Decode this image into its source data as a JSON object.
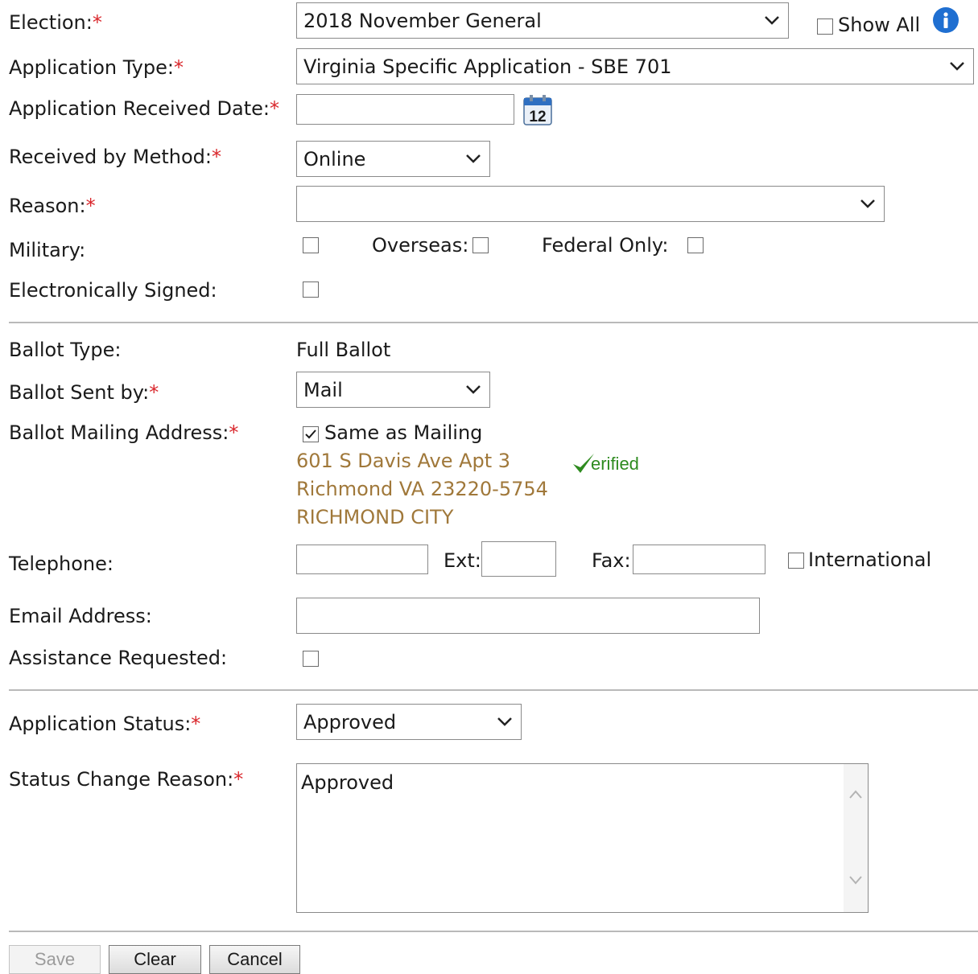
{
  "election": {
    "label": "Election:",
    "value": "2018 November General",
    "show_all_label": "Show All",
    "show_all_checked": false
  },
  "application_type": {
    "label": "Application Type:",
    "value": "Virginia Specific Application - SBE 701"
  },
  "received_date": {
    "label": "Application Received Date:",
    "value": "",
    "calendar_day": "12"
  },
  "received_method": {
    "label": "Received by Method:",
    "value": "Online"
  },
  "reason": {
    "label": "Reason:",
    "value": ""
  },
  "military": {
    "label": "Military:",
    "checked": false
  },
  "overseas": {
    "label": "Overseas:",
    "checked": false
  },
  "federal_only": {
    "label": "Federal Only:",
    "checked": false
  },
  "electronically_signed": {
    "label": "Electronically Signed:",
    "checked": false
  },
  "ballot_type": {
    "label": "Ballot Type:",
    "value": "Full Ballot"
  },
  "ballot_sent_by": {
    "label": "Ballot Sent by:",
    "value": "Mail"
  },
  "ballot_mailing_address": {
    "label": "Ballot Mailing Address:",
    "same_as_mailing_label": "Same as Mailing",
    "same_as_mailing_checked": true,
    "line1": "601 S Davis Ave Apt 3",
    "line2": "Richmond VA 23220-5754",
    "line3": "RICHMOND CITY",
    "verified_text": "erified"
  },
  "telephone": {
    "label": "Telephone:",
    "value": "",
    "ext_label": "Ext:",
    "fax_label": "Fax:",
    "international_label": "International",
    "international_checked": false
  },
  "email": {
    "label": "Email Address:",
    "value": ""
  },
  "assistance": {
    "label": "Assistance Requested:",
    "checked": false
  },
  "application_status": {
    "label": "Application Status:",
    "value": "Approved"
  },
  "status_change_reason": {
    "label": "Status Change Reason:",
    "value": "Approved"
  },
  "required_marker": "*",
  "buttons": {
    "save": "Save",
    "clear": "Clear",
    "cancel": "Cancel"
  },
  "colors": {
    "required": "#d9262b",
    "address": "#a0783a",
    "verified": "#2e8b1f",
    "info_icon": "#1f6fd1"
  }
}
